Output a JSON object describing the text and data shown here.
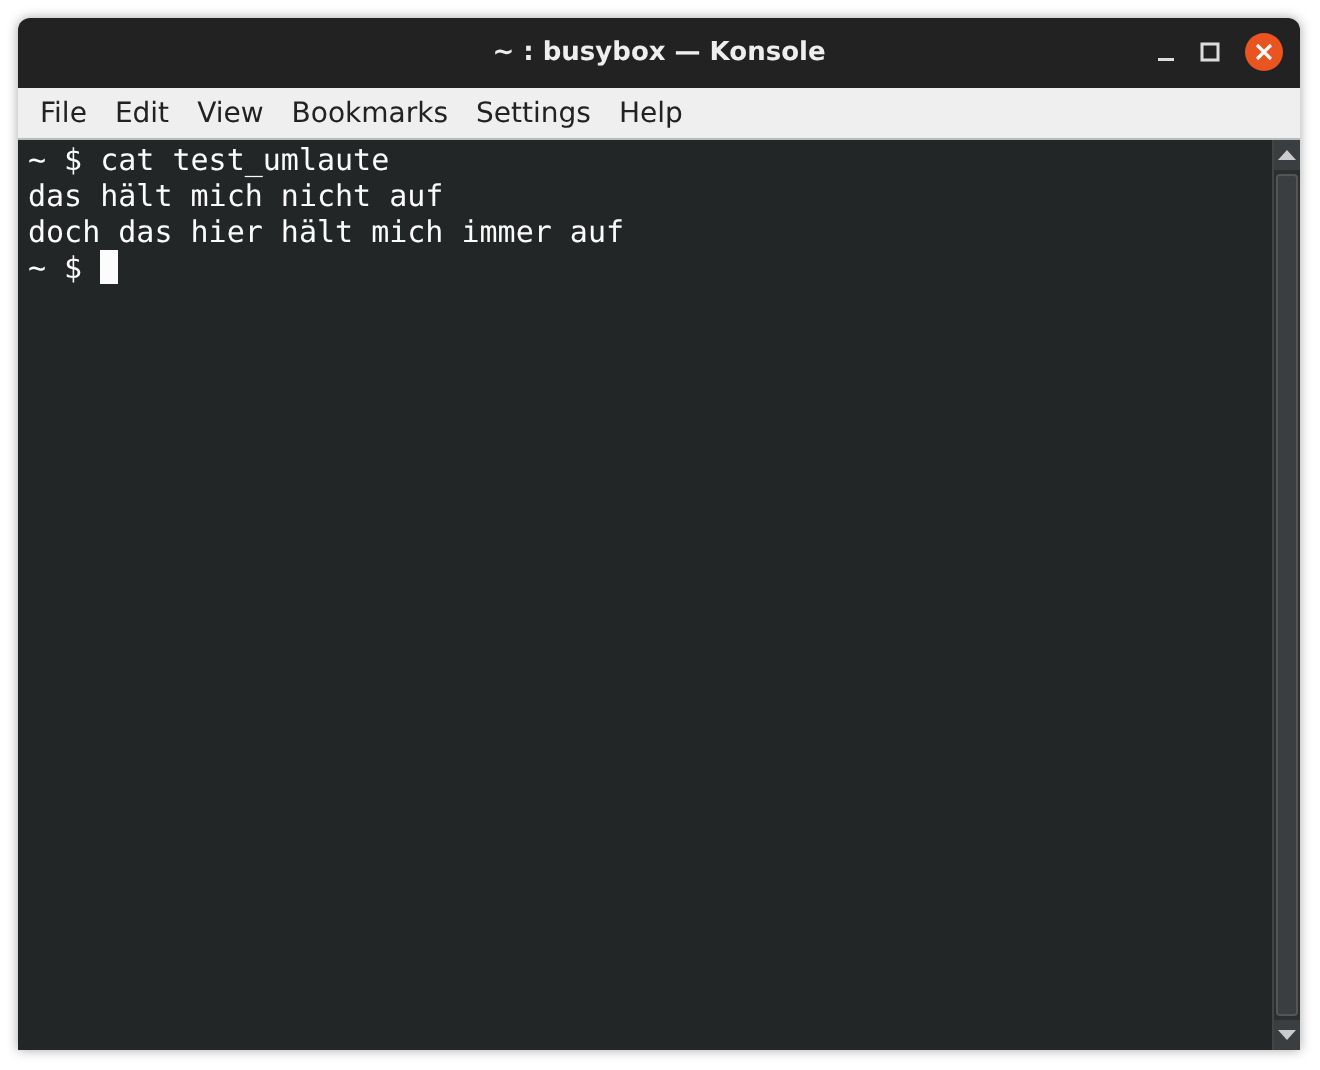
{
  "window": {
    "title": "~ : busybox — Konsole"
  },
  "menu": [
    "File",
    "Edit",
    "View",
    "Bookmarks",
    "Settings",
    "Help"
  ],
  "terminal": {
    "lines": [
      "~ $ cat test_umlaute",
      "das hält mich nicht auf",
      "doch das hier hält mich immer auf"
    ],
    "prompt": "~ $ ",
    "cursor": true
  }
}
